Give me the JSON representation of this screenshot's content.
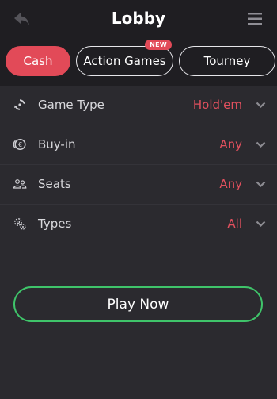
{
  "header": {
    "title": "Lobby",
    "back_icon": "back-arrow-icon",
    "menu_icon": "hamburger-menu-icon"
  },
  "tabs": [
    {
      "label": "Cash",
      "active": true
    },
    {
      "label": "Action Games",
      "active": false,
      "badge": "NEW"
    },
    {
      "label": "Tourney",
      "active": false
    }
  ],
  "filters": [
    {
      "label": "Game Type",
      "value": "Hold'em",
      "icon": "refresh-cycle-icon"
    },
    {
      "label": "Buy-in",
      "value": "Any",
      "icon": "coin-euro-icon"
    },
    {
      "label": "Seats",
      "value": "Any",
      "icon": "users-icon"
    },
    {
      "label": "Types",
      "value": "All",
      "icon": "gears-icon"
    }
  ],
  "play_button": {
    "label": "Play Now"
  },
  "colors": {
    "accent_red": "#e24a58",
    "play_green": "#3fc46a",
    "background": "#2b2a2f",
    "header_bg": "#1f1e22"
  }
}
